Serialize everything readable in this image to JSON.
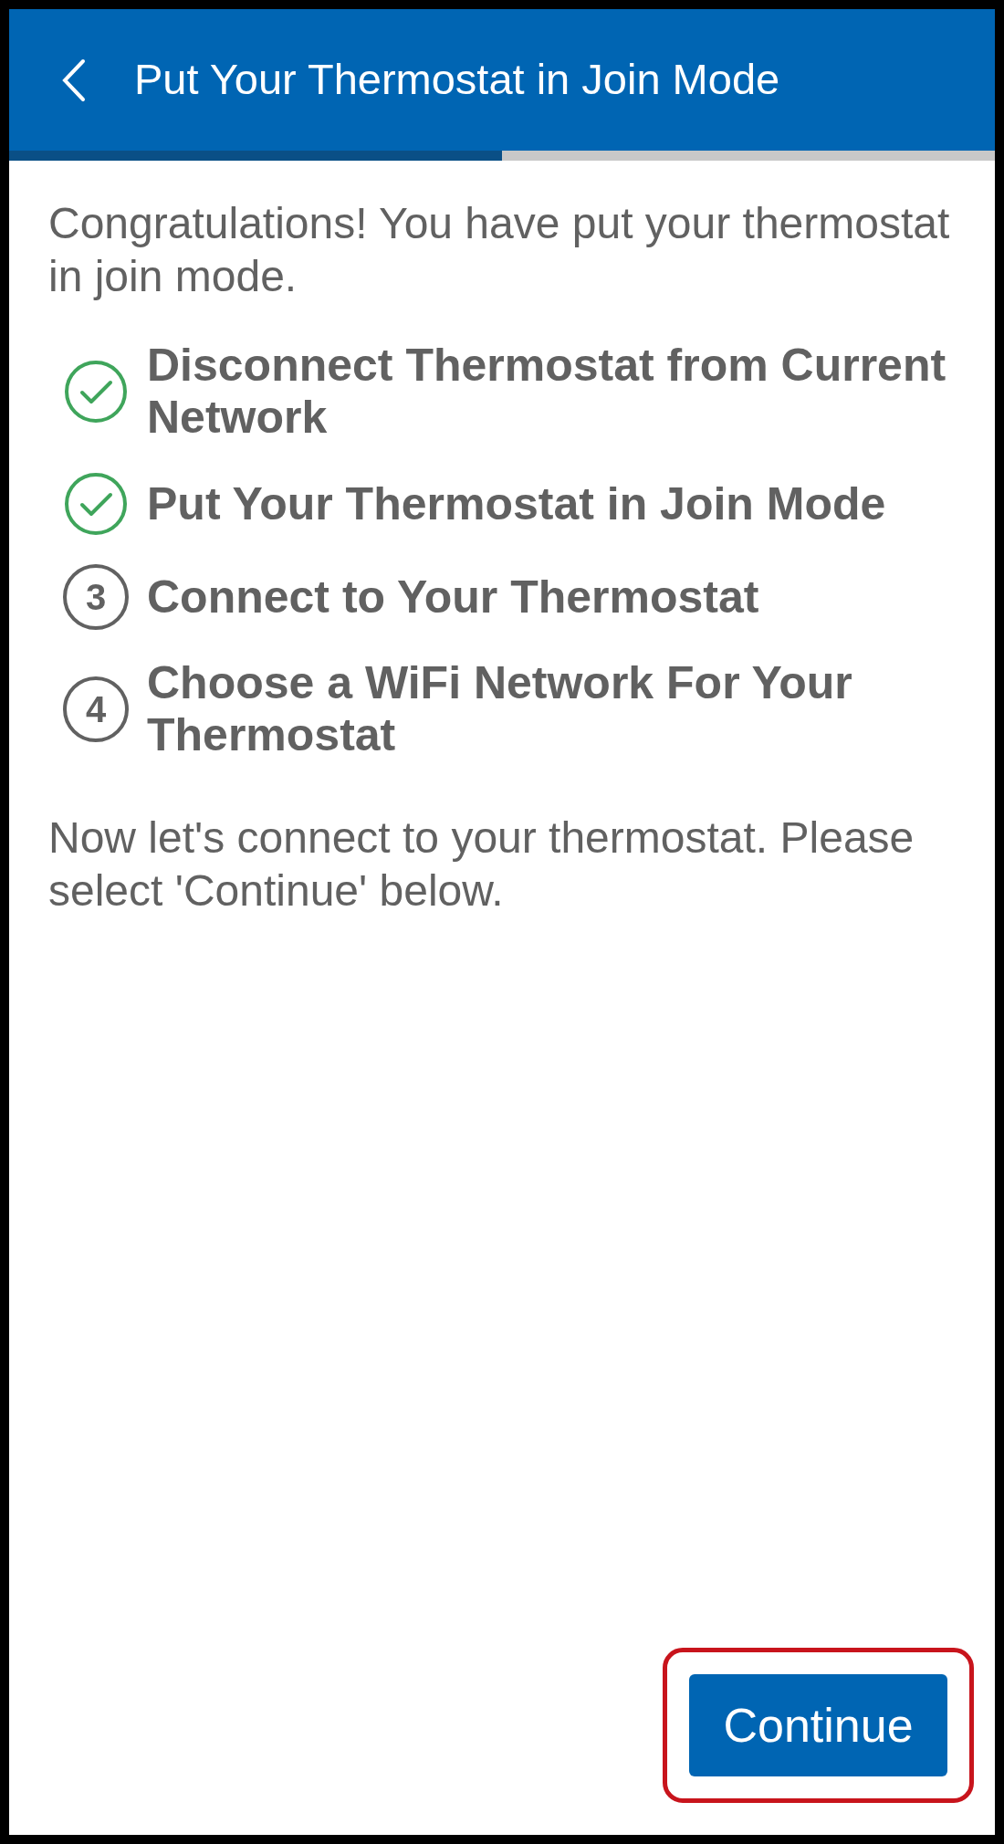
{
  "header": {
    "title": "Put Your Thermostat in Join Mode"
  },
  "progress": {
    "level": 0.5
  },
  "intro": "Congratulations! You have put your thermostat in join mode.",
  "steps": [
    {
      "kind": "check",
      "label": "Disconnect Thermostat from Current Network"
    },
    {
      "kind": "check",
      "label": "Put Your Thermostat in Join Mode"
    },
    {
      "kind": "number",
      "number": "3",
      "label": "Connect to Your Thermostat"
    },
    {
      "kind": "number",
      "number": "4",
      "label": "Choose a WiFi Network For Your Thermostat"
    }
  ],
  "instruction": "Now let's connect to your thermostat. Please select 'Continue' below.",
  "continue_button": {
    "label": "Continue",
    "highlighted": true
  }
}
